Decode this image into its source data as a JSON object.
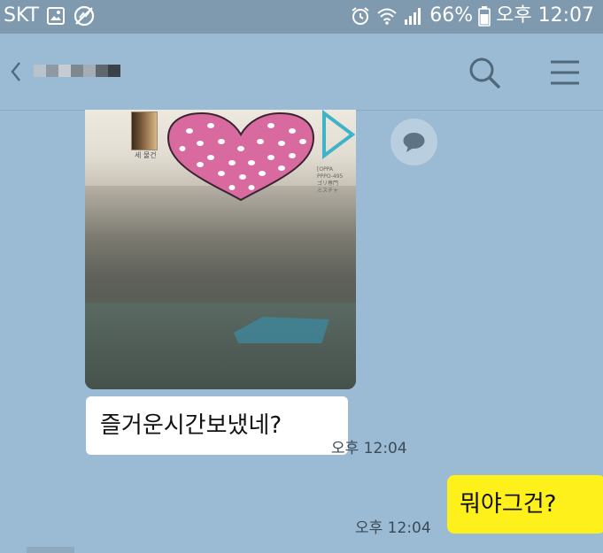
{
  "status_bar": {
    "carrier": "SKT",
    "battery": "66%",
    "time_label": "오후 12:07",
    "icons": [
      "image-icon",
      "no-sync-icon",
      "alarm-icon",
      "wifi-icon",
      "signal-icon",
      "battery-icon"
    ]
  },
  "header": {
    "back_icon": "chevron-left-icon",
    "contact_name_pixelated": true,
    "search_icon": "search-icon",
    "menu_icon": "menu-icon"
  },
  "messages": [
    {
      "sender": "other",
      "type": "photo",
      "time": ""
    },
    {
      "sender": "other",
      "type": "text",
      "text": "즐거운시간보냈네?",
      "time": "오후 12:04"
    },
    {
      "sender": "me",
      "type": "text",
      "text": "뭐야그건?",
      "time": "오후 12:04"
    }
  ],
  "photo": {
    "tile_caption": "세 물건",
    "right_text": "[OPPA\nPPPO-495\nゴリ専門\nミスチャ"
  },
  "colors": {
    "chat_background": "#9bbbd4",
    "status_bar": "#7f9aae",
    "my_bubble": "#fef01b",
    "other_bubble": "#ffffff"
  }
}
